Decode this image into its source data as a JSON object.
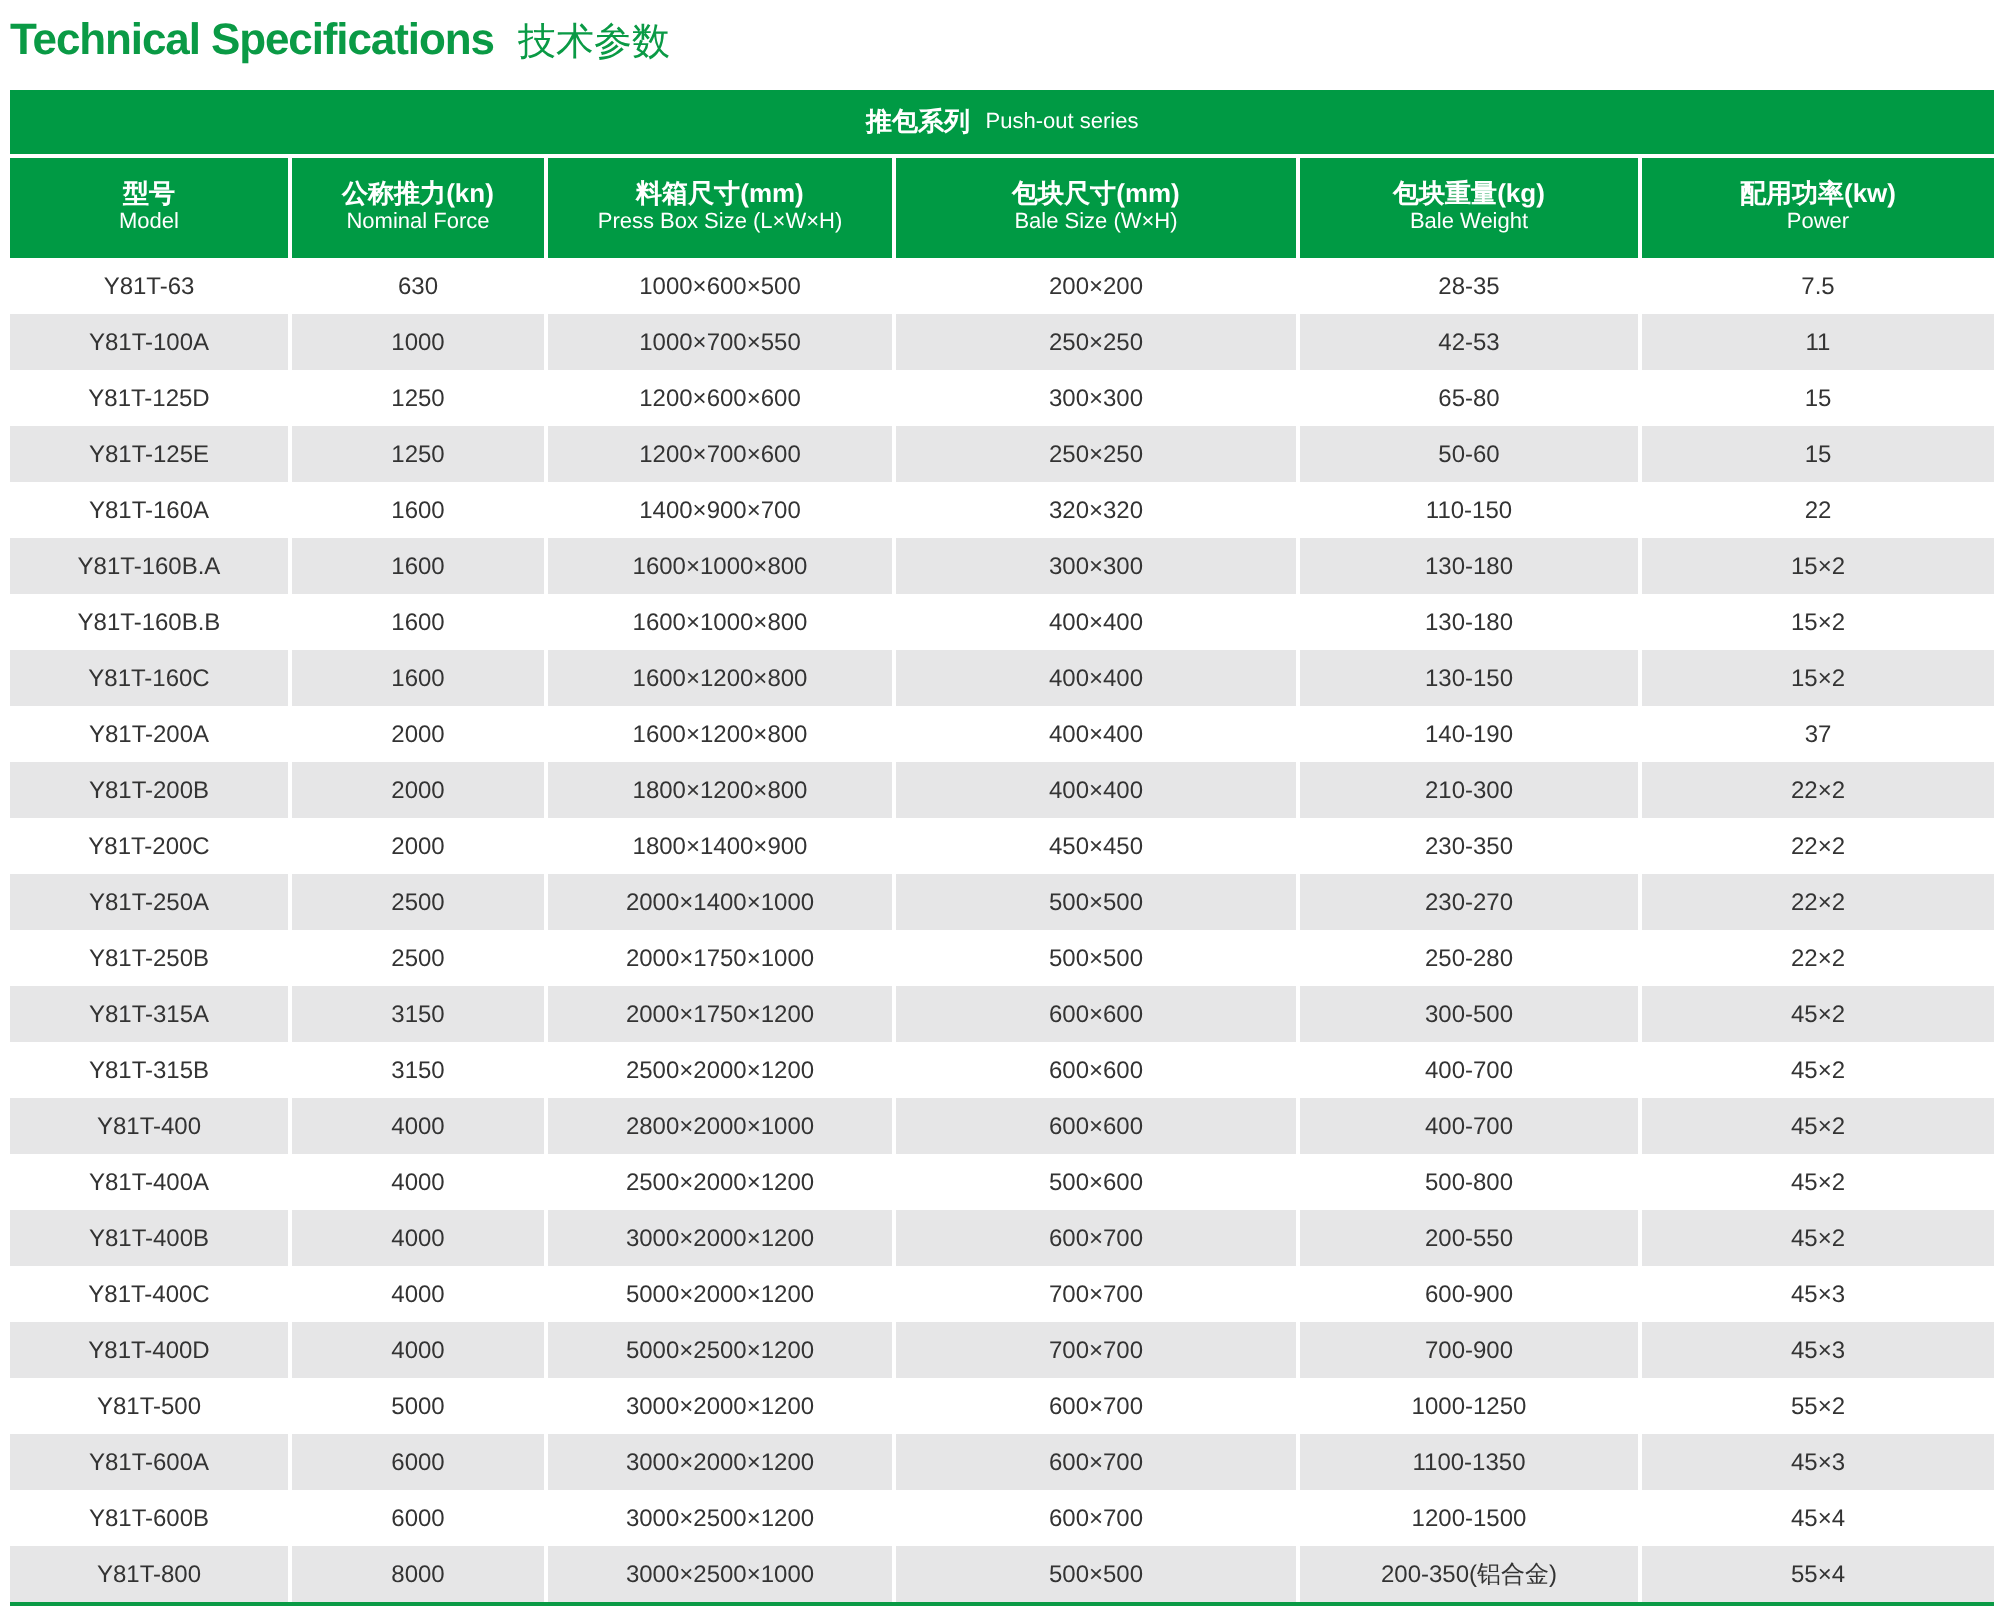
{
  "title": {
    "en": "Technical Specifications",
    "zh": "技术参数"
  },
  "table": {
    "series": {
      "zh": "推包系列",
      "en": "Push-out series"
    },
    "columns": [
      {
        "zh": "型号",
        "en": "Model"
      },
      {
        "zh": "公称推力(kn)",
        "en": "Nominal Force"
      },
      {
        "zh": "料箱尺寸(mm)",
        "en": "Press Box Size (L×W×H)"
      },
      {
        "zh": "包块尺寸(mm)",
        "en": "Bale Size (W×H)"
      },
      {
        "zh": "包块重量(kg)",
        "en": "Bale Weight"
      },
      {
        "zh": "配用功率(kw)",
        "en": "Power"
      }
    ],
    "rows": [
      [
        "Y81T-63",
        "630",
        "1000×600×500",
        "200×200",
        "28-35",
        "7.5"
      ],
      [
        "Y81T-100A",
        "1000",
        "1000×700×550",
        "250×250",
        "42-53",
        "11"
      ],
      [
        "Y81T-125D",
        "1250",
        "1200×600×600",
        "300×300",
        "65-80",
        "15"
      ],
      [
        "Y81T-125E",
        "1250",
        "1200×700×600",
        "250×250",
        "50-60",
        "15"
      ],
      [
        "Y81T-160A",
        "1600",
        "1400×900×700",
        "320×320",
        "110-150",
        "22"
      ],
      [
        "Y81T-160B.A",
        "1600",
        "1600×1000×800",
        "300×300",
        "130-180",
        "15×2"
      ],
      [
        "Y81T-160B.B",
        "1600",
        "1600×1000×800",
        "400×400",
        "130-180",
        "15×2"
      ],
      [
        "Y81T-160C",
        "1600",
        "1600×1200×800",
        "400×400",
        "130-150",
        "15×2"
      ],
      [
        "Y81T-200A",
        "2000",
        "1600×1200×800",
        "400×400",
        "140-190",
        "37"
      ],
      [
        "Y81T-200B",
        "2000",
        "1800×1200×800",
        "400×400",
        "210-300",
        "22×2"
      ],
      [
        "Y81T-200C",
        "2000",
        "1800×1400×900",
        "450×450",
        "230-350",
        "22×2"
      ],
      [
        "Y81T-250A",
        "2500",
        "2000×1400×1000",
        "500×500",
        "230-270",
        "22×2"
      ],
      [
        "Y81T-250B",
        "2500",
        "2000×1750×1000",
        "500×500",
        "250-280",
        "22×2"
      ],
      [
        "Y81T-315A",
        "3150",
        "2000×1750×1200",
        "600×600",
        "300-500",
        "45×2"
      ],
      [
        "Y81T-315B",
        "3150",
        "2500×2000×1200",
        "600×600",
        "400-700",
        "45×2"
      ],
      [
        "Y81T-400",
        "4000",
        "2800×2000×1000",
        "600×600",
        "400-700",
        "45×2"
      ],
      [
        "Y81T-400A",
        "4000",
        "2500×2000×1200",
        "500×600",
        "500-800",
        "45×2"
      ],
      [
        "Y81T-400B",
        "4000",
        "3000×2000×1200",
        "600×700",
        "200-550",
        "45×2"
      ],
      [
        "Y81T-400C",
        "4000",
        "5000×2000×1200",
        "700×700",
        "600-900",
        "45×3"
      ],
      [
        "Y81T-400D",
        "4000",
        "5000×2500×1200",
        "700×700",
        "700-900",
        "45×3"
      ],
      [
        "Y81T-500",
        "5000",
        "3000×2000×1200",
        "600×700",
        "1000-1250",
        "55×2"
      ],
      [
        "Y81T-600A",
        "6000",
        "3000×2000×1200",
        "600×700",
        "1100-1350",
        "45×3"
      ],
      [
        "Y81T-600B",
        "6000",
        "3000×2500×1200",
        "600×700",
        "1200-1500",
        "45×4"
      ],
      [
        "Y81T-800",
        "8000",
        "3000×2500×1000",
        "500×500",
        "200-350(铝合金)",
        "55×4"
      ]
    ]
  }
}
